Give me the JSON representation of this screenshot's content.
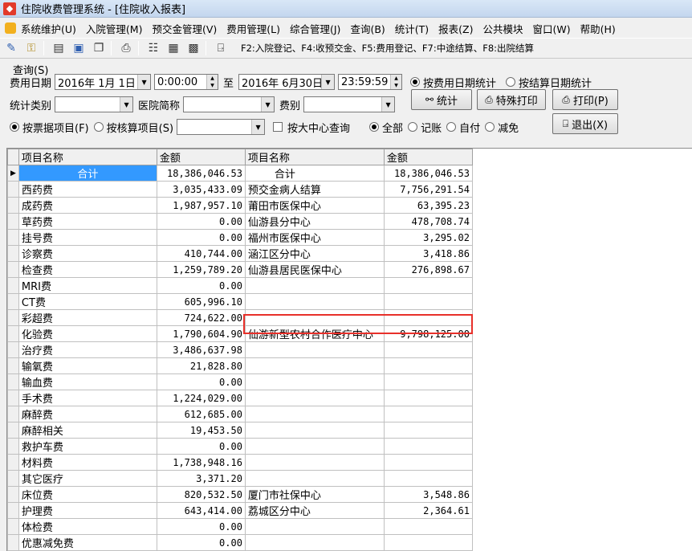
{
  "window": {
    "title": "住院收费管理系统 - [住院收入报表]"
  },
  "menu": [
    "系统维护(U)",
    "入院管理(M)",
    "预交金管理(V)",
    "费用管理(L)",
    "综合管理(J)",
    "查询(B)",
    "统计(T)",
    "报表(Z)",
    "公共模块",
    "窗口(W)",
    "帮助(H)"
  ],
  "toolbar": {
    "hotkeys": "F2:入院登记、F4:收预交金、F5:费用登记、F7:中途结算、F8:出院结算"
  },
  "query": {
    "legend": "查询(S)",
    "date_label": "费用日期",
    "date_from": "2016年  1月  1日",
    "time_from": "0:00:00",
    "to_label": "至",
    "date_to": "2016年  6月30日",
    "time_to": "23:59:59",
    "radio_by_fee_date": "按费用日期统计",
    "radio_by_settle_date": "按结算日期统计",
    "stat_type_label": "统计类别",
    "hospital_label": "医院简称",
    "fee_type_label": "费别",
    "btn_stat": "统计",
    "btn_special_print": "特殊打印",
    "btn_print": "打印(P)",
    "radio_by_receipt": "按票据项目(F)",
    "radio_by_audit": "按核算项目(S)",
    "check_big_center": "按大中心查询",
    "radio_all": "全部",
    "radio_account": "记账",
    "radio_self": "自付",
    "radio_reduce": "减免",
    "btn_exit": "退出(X)"
  },
  "grid": {
    "headers": [
      "项目名称",
      "金额",
      "项目名称",
      "金额"
    ],
    "rows": [
      [
        "合计",
        "18,386,046.53",
        "合计",
        "18,386,046.53"
      ],
      [
        "西药费",
        "3,035,433.09",
        "预交金病人结算",
        "7,756,291.54"
      ],
      [
        "成药费",
        "1,987,957.10",
        "莆田市医保中心",
        "63,395.23"
      ],
      [
        "草药费",
        "0.00",
        "仙游县分中心",
        "478,708.74"
      ],
      [
        "挂号费",
        "0.00",
        "福州市医保中心",
        "3,295.02"
      ],
      [
        "诊察费",
        "410,744.00",
        "涵江区分中心",
        "3,418.86"
      ],
      [
        "检查费",
        "1,259,789.20",
        "仙游县居民医保中心",
        "276,898.67"
      ],
      [
        "MRI费",
        "0.00",
        "",
        ""
      ],
      [
        "CT费",
        "605,996.10",
        "",
        ""
      ],
      [
        "彩超费",
        "724,622.00",
        "",
        ""
      ],
      [
        "化验费",
        "1,790,604.90",
        "仙游新型农村合作医疗中心",
        "9,798,125.00"
      ],
      [
        "治疗费",
        "3,486,637.98",
        "",
        ""
      ],
      [
        "输氧费",
        "21,828.80",
        "",
        ""
      ],
      [
        "输血费",
        "0.00",
        "",
        ""
      ],
      [
        "手术费",
        "1,224,029.00",
        "",
        ""
      ],
      [
        "麻醉费",
        "612,685.00",
        "",
        ""
      ],
      [
        "麻醉相关",
        "19,453.50",
        "",
        ""
      ],
      [
        "救护车费",
        "0.00",
        "",
        ""
      ],
      [
        "材料费",
        "1,738,948.16",
        "",
        ""
      ],
      [
        "其它医疗",
        "3,371.20",
        "",
        ""
      ],
      [
        "床位费",
        "820,532.50",
        "厦门市社保中心",
        "3,548.86"
      ],
      [
        "护理费",
        "643,414.00",
        "荔城区分中心",
        "2,364.61"
      ],
      [
        "体检费",
        "0.00",
        "",
        ""
      ],
      [
        "优惠减免费",
        "0.00",
        "",
        ""
      ]
    ]
  }
}
